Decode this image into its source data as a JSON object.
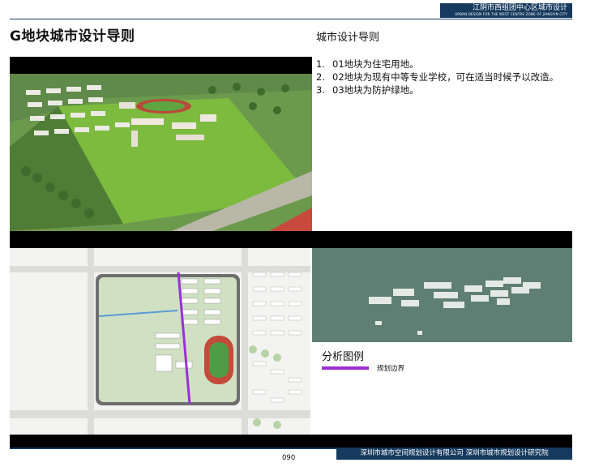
{
  "header": {
    "brand_title": "江阴市西组团中心区城市设计",
    "brand_subtitle": "URBAN DESIGN FOR THE WEST CENTRE ZONE OF JIANGYIN CITY"
  },
  "page": {
    "title": "G地块城市设计导则",
    "guide_heading": "城市设计导则",
    "guidelines": [
      {
        "num": "1.",
        "text": "01地块为住宅用地。"
      },
      {
        "num": "2.",
        "text": "02地块为现有中等专业学校，可在适当时候予以改造。"
      },
      {
        "num": "3.",
        "text": "03地块为防护绿地。"
      }
    ]
  },
  "legend": {
    "heading": "分析图例",
    "items": [
      {
        "label": "规划边界",
        "color": "#9b2fd6"
      }
    ]
  },
  "footer": {
    "org": "深圳市城市空间规划设计有限公司  深圳市城市规划设计研究院",
    "page_number": "090"
  }
}
